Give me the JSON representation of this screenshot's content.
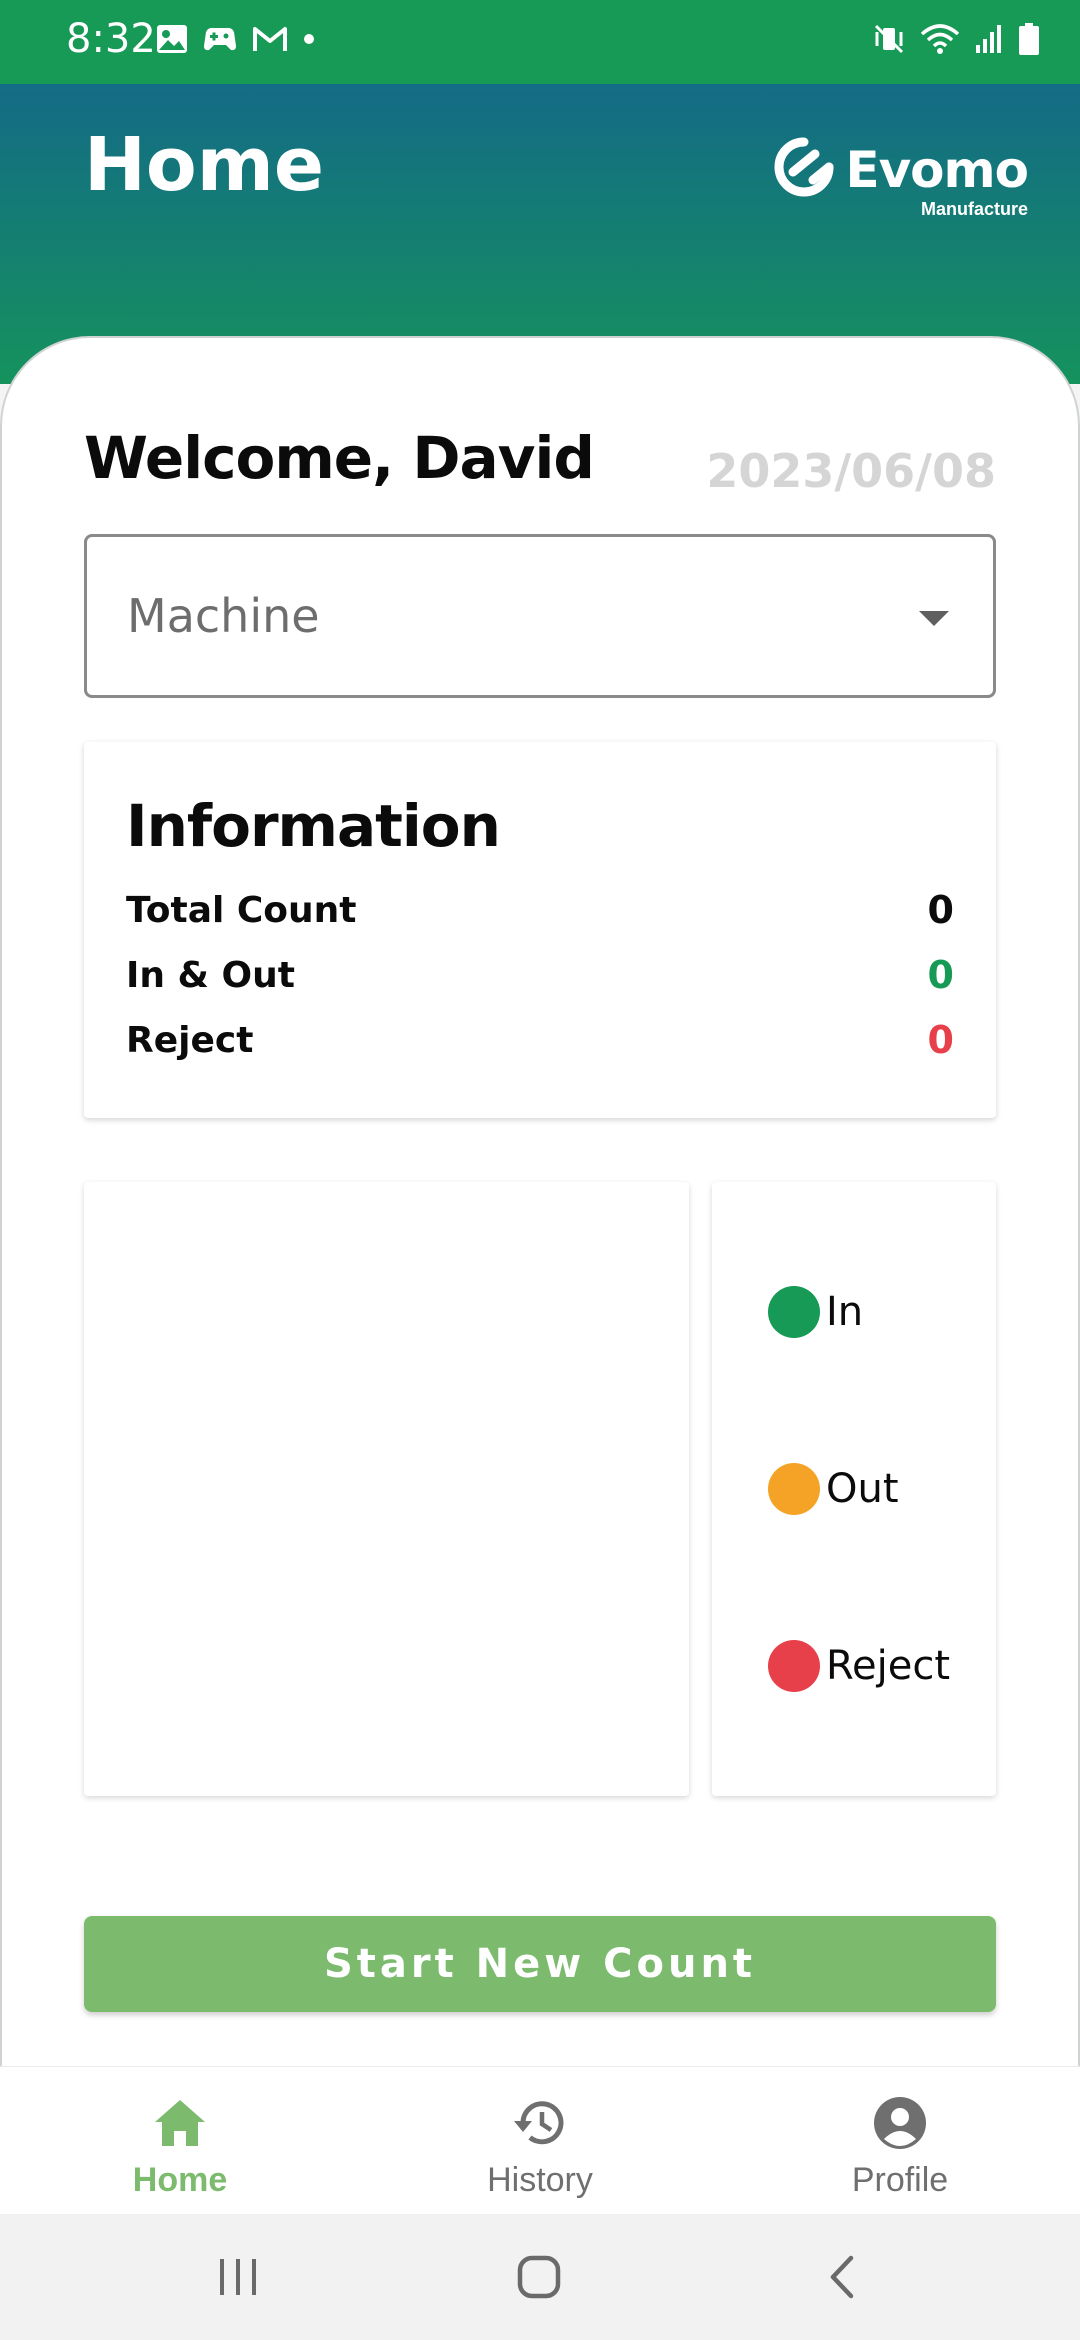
{
  "status_bar": {
    "time": "8:32",
    "left_icons": [
      "image-icon",
      "game-controller-icon",
      "gmail-icon",
      "dot-icon"
    ],
    "right_icons": [
      "vibrate-mute-icon",
      "wifi-icon",
      "signal-icon",
      "battery-icon"
    ]
  },
  "header": {
    "title": "Home",
    "logo_text": "Evomo",
    "logo_subtext": "Manufacture"
  },
  "welcome": {
    "greeting": "Welcome, David",
    "date": "2023/06/08"
  },
  "machine_select": {
    "placeholder": "Machine",
    "icon": "chevron-down-icon"
  },
  "information": {
    "title": "Information",
    "rows": [
      {
        "label": "Total Count",
        "value": "0",
        "color": "#0b0b0b"
      },
      {
        "label": "In & Out",
        "value": "0",
        "color": "#169a55"
      },
      {
        "label": "Reject",
        "value": "0",
        "color": "#e8404a"
      }
    ]
  },
  "legend": {
    "items": [
      {
        "label": "In",
        "color": "#169a55"
      },
      {
        "label": "Out",
        "color": "#f4a326"
      },
      {
        "label": "Reject",
        "color": "#e8404a"
      }
    ]
  },
  "actions": {
    "start_button": "Start New Count"
  },
  "bottom_nav": {
    "active_color": "#7cbb6e",
    "inactive_color": "#6f6f6f",
    "items": [
      {
        "label": "Home",
        "icon": "home-icon",
        "active": true
      },
      {
        "label": "History",
        "icon": "history-icon",
        "active": false
      },
      {
        "label": "Profile",
        "icon": "profile-icon",
        "active": false
      }
    ]
  },
  "system_nav": {
    "buttons": [
      "recents-icon",
      "home-circle-icon",
      "back-icon"
    ]
  }
}
